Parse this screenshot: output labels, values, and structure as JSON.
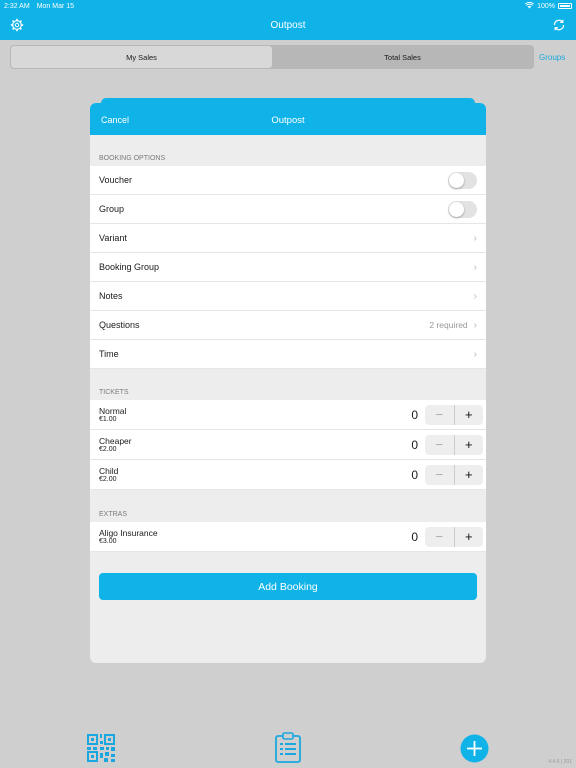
{
  "status": {
    "time": "2:32 AM",
    "date": "Mon Mar 15",
    "battery": "100%"
  },
  "nav": {
    "title": "Outpost"
  },
  "segments": {
    "my_sales": "My Sales",
    "total_sales": "Total Sales",
    "groups": "Groups"
  },
  "modal": {
    "cancel": "Cancel",
    "title": "Outpost",
    "booking_header": "BOOKING OPTIONS",
    "voucher": "Voucher",
    "group": "Group",
    "variant": "Variant",
    "booking_group": "Booking Group",
    "notes": "Notes",
    "questions": "Questions",
    "questions_value": "2 required",
    "time": "Time",
    "tickets_header": "TICKETS",
    "tickets": [
      {
        "name": "Normal",
        "price": "€1.00",
        "qty": "0"
      },
      {
        "name": "Cheaper",
        "price": "€2.00",
        "qty": "0"
      },
      {
        "name": "Child",
        "price": "€2.00",
        "qty": "0"
      }
    ],
    "extras_header": "EXTRAS",
    "extras": [
      {
        "name": "Aligo Insurance",
        "price": "€3.00",
        "qty": "0"
      }
    ],
    "add_booking": "Add Booking"
  },
  "footer": {
    "version": "4.4.6 | 201"
  },
  "colors": {
    "accent": "#0fb3e8",
    "background": "#cfcfcf"
  },
  "icons": {
    "settings": "gear-icon",
    "refresh": "refresh-icon",
    "qr": "qr-code-icon",
    "clipboard": "clipboard-icon",
    "add": "plus-circle-icon",
    "chevron": "chevron-right-icon"
  }
}
